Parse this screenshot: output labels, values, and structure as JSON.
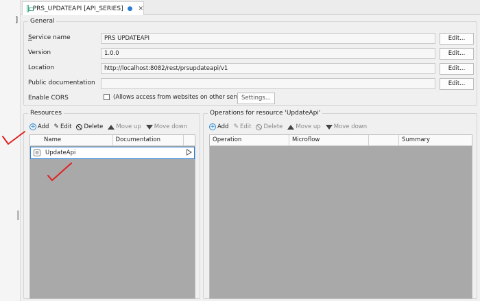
{
  "tab": {
    "title": "PRS_UPDATEAPI [API_SERIES]",
    "dirty_marker": "●",
    "close": "✕"
  },
  "left_strip": {
    "brace": "]"
  },
  "general": {
    "legend": "General",
    "service_name": {
      "label": "Service name",
      "value": "PRS UPDATEAPI",
      "edit": "Edit..."
    },
    "version": {
      "label": "Version",
      "value": "1.0.0",
      "edit": "Edit..."
    },
    "location": {
      "label": "Location",
      "value": "http://localhost:8082/rest/prsupdateapi/v1",
      "edit": "Edit..."
    },
    "public_documentation": {
      "label": "Public documentation",
      "value": "",
      "edit": "Edit..."
    },
    "enable_cors": {
      "label": "Enable CORS",
      "checked": false,
      "text": "(Allows access from websites on other servers)",
      "settings": "Settings..."
    }
  },
  "resources": {
    "legend": "Resources",
    "toolbar": {
      "add": "Add",
      "edit": "Edit",
      "delete": "Delete",
      "move_up": "Move up",
      "move_down": "Move down"
    },
    "columns": [
      "Name",
      "Documentation"
    ],
    "rows": [
      {
        "name": "UpdateApi",
        "documentation": ""
      }
    ]
  },
  "operations": {
    "legend": "Operations for resource 'UpdateApi'",
    "toolbar": {
      "add": "Add",
      "edit": "Edit",
      "delete": "Delete",
      "move_up": "Move up",
      "move_down": "Move down"
    },
    "columns": [
      "Operation",
      "Microflow",
      "",
      "Summary"
    ],
    "rows": []
  },
  "colors": {
    "accent": "#2a7dd6",
    "annotation": "#e02020",
    "grid_empty": "#a9a9a9"
  }
}
